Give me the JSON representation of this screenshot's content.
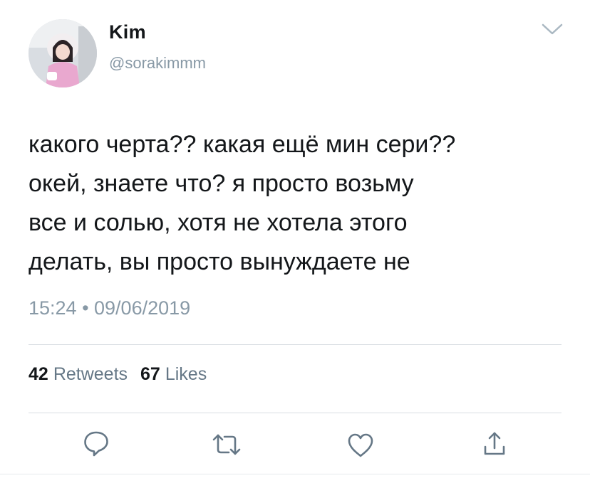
{
  "user": {
    "display_name": "Kim",
    "handle": "@sorakimmm",
    "avatar_icon": "user-avatar-photo"
  },
  "tweet": {
    "text": "какого черта?? какая ещё мин сери??\nокей, знаете что? я просто возьму\nвсе и солью, хотя не хотела этого\nделать, вы просто вынуждаете не",
    "timestamp": "15:24 • 09/06/2019"
  },
  "stats": {
    "retweets_count": "42",
    "retweets_label": "Retweets",
    "likes_count": "67",
    "likes_label": "Likes"
  },
  "actions": {
    "icons": [
      "reply-icon",
      "retweet-icon",
      "like-icon",
      "share-icon"
    ],
    "color": "#657786"
  },
  "colors": {
    "text": "#14171a",
    "secondary": "#8899a6",
    "icon": "#657786",
    "divider": "#d8dde2"
  }
}
